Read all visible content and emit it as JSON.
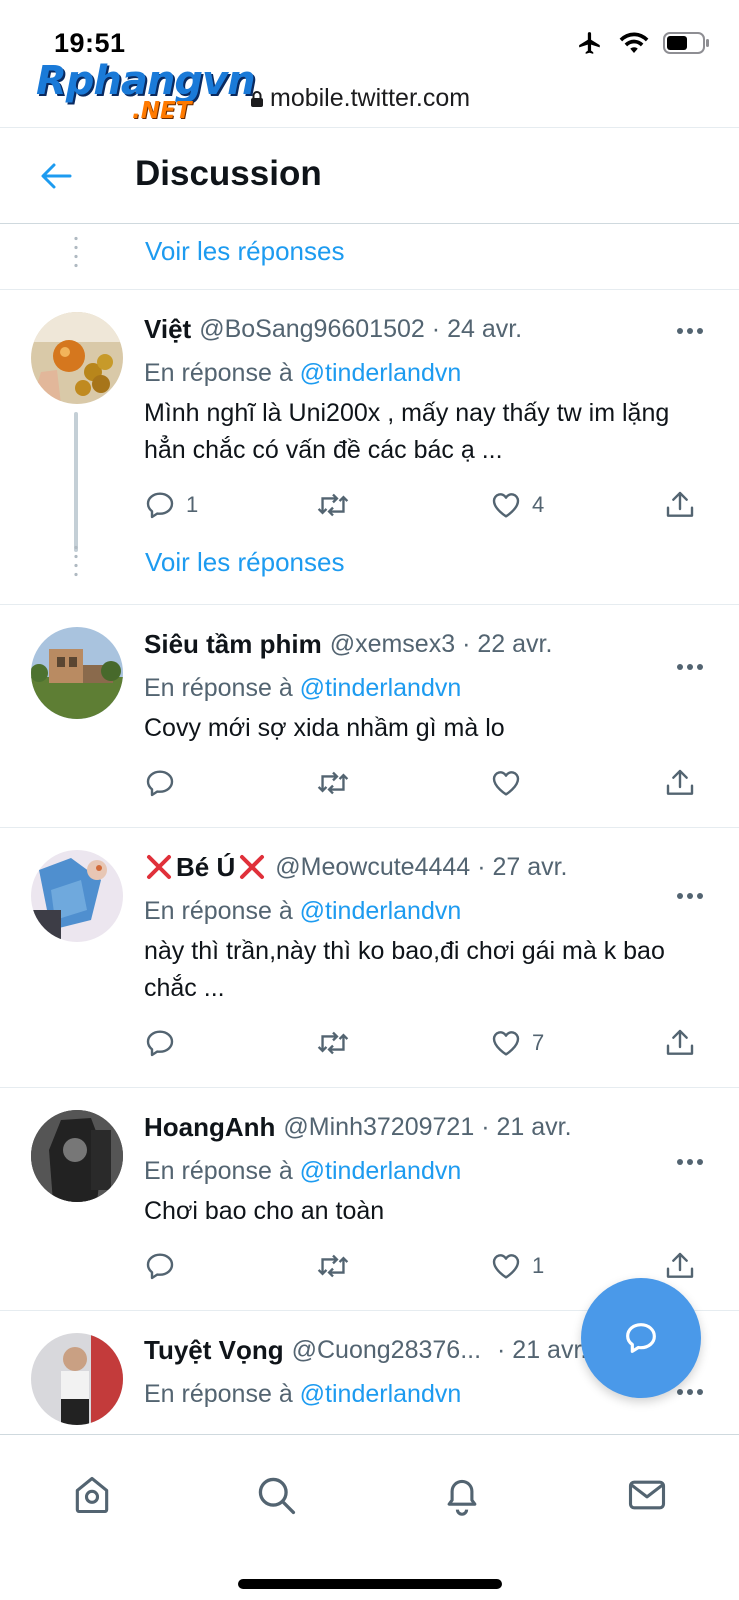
{
  "status_bar": {
    "time": "19:51"
  },
  "watermark": {
    "main": "Rphangvn",
    "suffix": ".NET"
  },
  "browser": {
    "url": "mobile.twitter.com"
  },
  "header": {
    "title": "Discussion",
    "back_icon": "arrow-left-icon"
  },
  "feed": {
    "top_show_replies": "Voir les réponses",
    "tweets": [
      {
        "name": "Việt",
        "handle": "@BoSang96601502",
        "date": "· 24 avr.",
        "reply_prefix": "En réponse à",
        "reply_mention": "@tinderlandvn",
        "text": "Mình nghĩ là Uni200x , mấy nay thấy tw im lặng hẳn chắc có vấn đề các bác ạ ...",
        "replies": "1",
        "retweets": "",
        "likes": "4",
        "show_replies": "Voir les réponses"
      },
      {
        "name": "Siêu tầm phim",
        "handle": "@xemsex3",
        "date": "· 22 avr.",
        "reply_prefix": "En réponse à",
        "reply_mention": "@tinderlandvn",
        "text": "Covy mới sợ xida nhầm gì mà lo",
        "replies": "",
        "retweets": "",
        "likes": ""
      },
      {
        "name": "Bé Ú",
        "handle": "@Meowcute4444",
        "date": "· 27 avr.",
        "reply_prefix": "En réponse à",
        "reply_mention": "@tinderlandvn",
        "text": "này thì trần,này thì ko bao,đi chơi gái mà k bao chắc ...",
        "replies": "",
        "retweets": "",
        "likes": "7"
      },
      {
        "name": "HoangAnh",
        "handle": "@Minh37209721",
        "date": "· 21 avr.",
        "reply_prefix": "En réponse à",
        "reply_mention": "@tinderlandvn",
        "text": "Chơi bao cho an toàn",
        "replies": "",
        "retweets": "",
        "likes": "1"
      },
      {
        "name": "Tuyệt Vọng",
        "handle": "@Cuong28376...",
        "date": "· 21 avr.",
        "reply_prefix": "En réponse à",
        "reply_mention": "@tinderlandvn"
      }
    ]
  },
  "colors": {
    "accent": "#1d9bf0",
    "fab": "#4a99e9",
    "muted": "#536471",
    "text": "#0f1419",
    "cross": "#e0303a"
  },
  "bottom_nav": [
    "home-icon",
    "search-icon",
    "notifications-icon",
    "messages-icon"
  ]
}
